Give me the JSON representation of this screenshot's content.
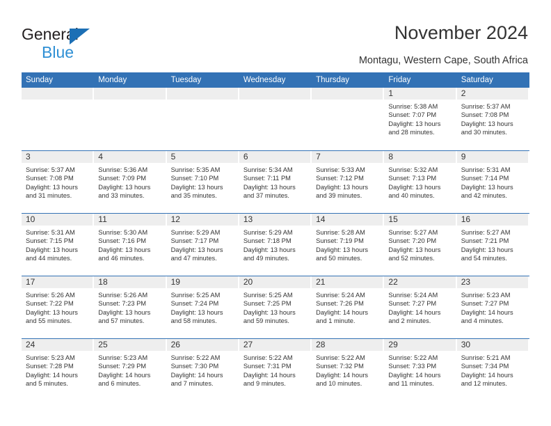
{
  "logo": {
    "line1": "General",
    "line2": "Blue",
    "triangle_color": "#1c6fb5",
    "blue_color": "#2e8fd4"
  },
  "header": {
    "title": "November 2024",
    "subtitle": "Montagu, Western Cape, South Africa",
    "accent_color": "#3372b5",
    "daynum_band_color": "#eeeeee"
  },
  "weekdays": [
    "Sunday",
    "Monday",
    "Tuesday",
    "Wednesday",
    "Thursday",
    "Friday",
    "Saturday"
  ],
  "labels": {
    "sunrise": "Sunrise:",
    "sunset": "Sunset:",
    "daylight": "Daylight:"
  },
  "weeks": [
    [
      {
        "day": "",
        "empty": true
      },
      {
        "day": "",
        "empty": true
      },
      {
        "day": "",
        "empty": true
      },
      {
        "day": "",
        "empty": true
      },
      {
        "day": "",
        "empty": true
      },
      {
        "day": "1",
        "sunrise": "Sunrise: 5:38 AM",
        "sunset": "Sunset: 7:07 PM",
        "daylight": "Daylight: 13 hours and 28 minutes."
      },
      {
        "day": "2",
        "sunrise": "Sunrise: 5:37 AM",
        "sunset": "Sunset: 7:08 PM",
        "daylight": "Daylight: 13 hours and 30 minutes."
      }
    ],
    [
      {
        "day": "3",
        "sunrise": "Sunrise: 5:37 AM",
        "sunset": "Sunset: 7:08 PM",
        "daylight": "Daylight: 13 hours and 31 minutes."
      },
      {
        "day": "4",
        "sunrise": "Sunrise: 5:36 AM",
        "sunset": "Sunset: 7:09 PM",
        "daylight": "Daylight: 13 hours and 33 minutes."
      },
      {
        "day": "5",
        "sunrise": "Sunrise: 5:35 AM",
        "sunset": "Sunset: 7:10 PM",
        "daylight": "Daylight: 13 hours and 35 minutes."
      },
      {
        "day": "6",
        "sunrise": "Sunrise: 5:34 AM",
        "sunset": "Sunset: 7:11 PM",
        "daylight": "Daylight: 13 hours and 37 minutes."
      },
      {
        "day": "7",
        "sunrise": "Sunrise: 5:33 AM",
        "sunset": "Sunset: 7:12 PM",
        "daylight": "Daylight: 13 hours and 39 minutes."
      },
      {
        "day": "8",
        "sunrise": "Sunrise: 5:32 AM",
        "sunset": "Sunset: 7:13 PM",
        "daylight": "Daylight: 13 hours and 40 minutes."
      },
      {
        "day": "9",
        "sunrise": "Sunrise: 5:31 AM",
        "sunset": "Sunset: 7:14 PM",
        "daylight": "Daylight: 13 hours and 42 minutes."
      }
    ],
    [
      {
        "day": "10",
        "sunrise": "Sunrise: 5:31 AM",
        "sunset": "Sunset: 7:15 PM",
        "daylight": "Daylight: 13 hours and 44 minutes."
      },
      {
        "day": "11",
        "sunrise": "Sunrise: 5:30 AM",
        "sunset": "Sunset: 7:16 PM",
        "daylight": "Daylight: 13 hours and 46 minutes."
      },
      {
        "day": "12",
        "sunrise": "Sunrise: 5:29 AM",
        "sunset": "Sunset: 7:17 PM",
        "daylight": "Daylight: 13 hours and 47 minutes."
      },
      {
        "day": "13",
        "sunrise": "Sunrise: 5:29 AM",
        "sunset": "Sunset: 7:18 PM",
        "daylight": "Daylight: 13 hours and 49 minutes."
      },
      {
        "day": "14",
        "sunrise": "Sunrise: 5:28 AM",
        "sunset": "Sunset: 7:19 PM",
        "daylight": "Daylight: 13 hours and 50 minutes."
      },
      {
        "day": "15",
        "sunrise": "Sunrise: 5:27 AM",
        "sunset": "Sunset: 7:20 PM",
        "daylight": "Daylight: 13 hours and 52 minutes."
      },
      {
        "day": "16",
        "sunrise": "Sunrise: 5:27 AM",
        "sunset": "Sunset: 7:21 PM",
        "daylight": "Daylight: 13 hours and 54 minutes."
      }
    ],
    [
      {
        "day": "17",
        "sunrise": "Sunrise: 5:26 AM",
        "sunset": "Sunset: 7:22 PM",
        "daylight": "Daylight: 13 hours and 55 minutes."
      },
      {
        "day": "18",
        "sunrise": "Sunrise: 5:26 AM",
        "sunset": "Sunset: 7:23 PM",
        "daylight": "Daylight: 13 hours and 57 minutes."
      },
      {
        "day": "19",
        "sunrise": "Sunrise: 5:25 AM",
        "sunset": "Sunset: 7:24 PM",
        "daylight": "Daylight: 13 hours and 58 minutes."
      },
      {
        "day": "20",
        "sunrise": "Sunrise: 5:25 AM",
        "sunset": "Sunset: 7:25 PM",
        "daylight": "Daylight: 13 hours and 59 minutes."
      },
      {
        "day": "21",
        "sunrise": "Sunrise: 5:24 AM",
        "sunset": "Sunset: 7:26 PM",
        "daylight": "Daylight: 14 hours and 1 minute."
      },
      {
        "day": "22",
        "sunrise": "Sunrise: 5:24 AM",
        "sunset": "Sunset: 7:27 PM",
        "daylight": "Daylight: 14 hours and 2 minutes."
      },
      {
        "day": "23",
        "sunrise": "Sunrise: 5:23 AM",
        "sunset": "Sunset: 7:27 PM",
        "daylight": "Daylight: 14 hours and 4 minutes."
      }
    ],
    [
      {
        "day": "24",
        "sunrise": "Sunrise: 5:23 AM",
        "sunset": "Sunset: 7:28 PM",
        "daylight": "Daylight: 14 hours and 5 minutes."
      },
      {
        "day": "25",
        "sunrise": "Sunrise: 5:23 AM",
        "sunset": "Sunset: 7:29 PM",
        "daylight": "Daylight: 14 hours and 6 minutes."
      },
      {
        "day": "26",
        "sunrise": "Sunrise: 5:22 AM",
        "sunset": "Sunset: 7:30 PM",
        "daylight": "Daylight: 14 hours and 7 minutes."
      },
      {
        "day": "27",
        "sunrise": "Sunrise: 5:22 AM",
        "sunset": "Sunset: 7:31 PM",
        "daylight": "Daylight: 14 hours and 9 minutes."
      },
      {
        "day": "28",
        "sunrise": "Sunrise: 5:22 AM",
        "sunset": "Sunset: 7:32 PM",
        "daylight": "Daylight: 14 hours and 10 minutes."
      },
      {
        "day": "29",
        "sunrise": "Sunrise: 5:22 AM",
        "sunset": "Sunset: 7:33 PM",
        "daylight": "Daylight: 14 hours and 11 minutes."
      },
      {
        "day": "30",
        "sunrise": "Sunrise: 5:21 AM",
        "sunset": "Sunset: 7:34 PM",
        "daylight": "Daylight: 14 hours and 12 minutes."
      }
    ]
  ]
}
